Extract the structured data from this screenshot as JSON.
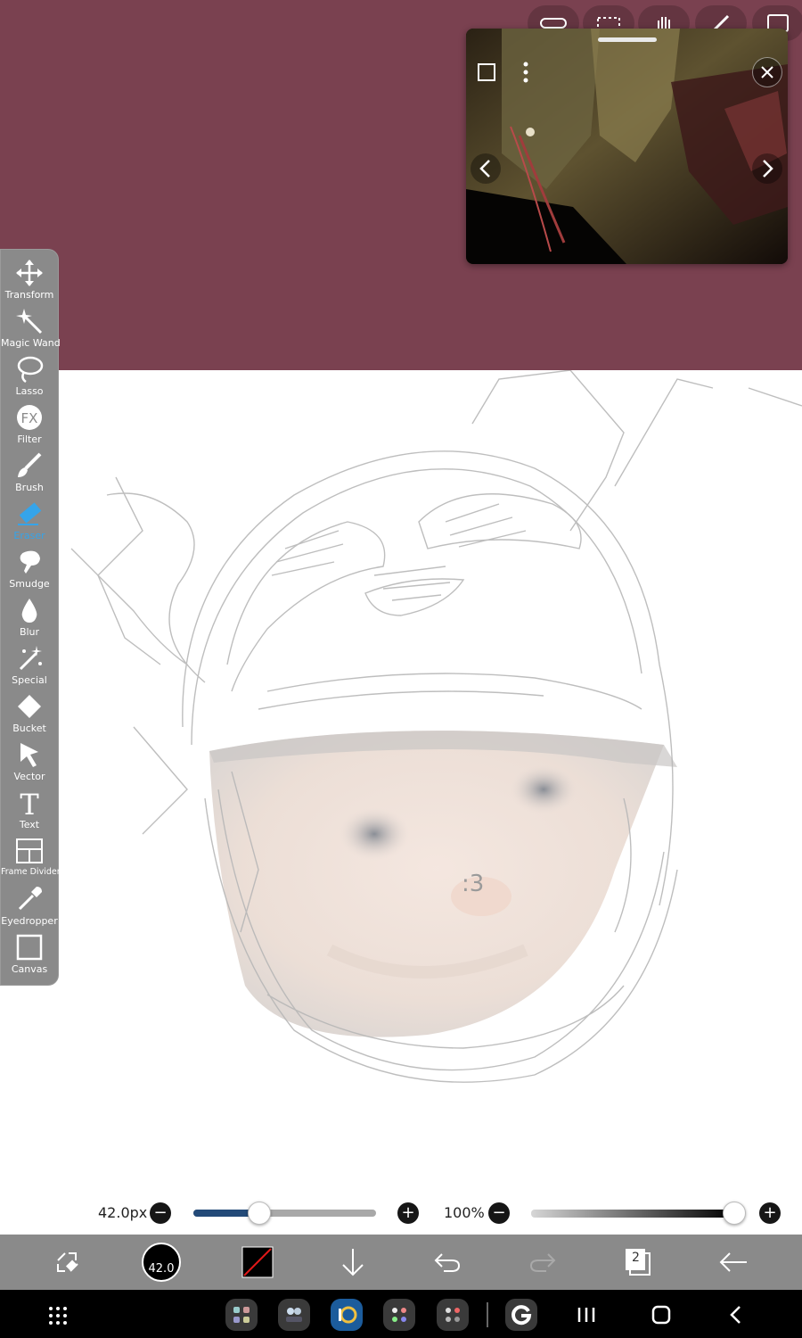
{
  "toolbar": {
    "tools": [
      {
        "label": "Transform",
        "icon": "move-arrows-icon"
      },
      {
        "label": "Magic Wand",
        "icon": "magic-wand-icon"
      },
      {
        "label": "Lasso",
        "icon": "lasso-icon"
      },
      {
        "label": "Filter",
        "icon": "fx-icon",
        "glyph": "FX"
      },
      {
        "label": "Brush",
        "icon": "brush-icon"
      },
      {
        "label": "Eraser",
        "icon": "eraser-icon",
        "active": true
      },
      {
        "label": "Smudge",
        "icon": "smudge-icon"
      },
      {
        "label": "Blur",
        "icon": "drop-icon"
      },
      {
        "label": "Special",
        "icon": "sparkle-wand-icon"
      },
      {
        "label": "Bucket",
        "icon": "bucket-icon"
      },
      {
        "label": "Vector",
        "icon": "pointer-arrow-icon"
      },
      {
        "label": "Text",
        "icon": "text-icon",
        "glyph": "T"
      },
      {
        "label": "Frame Divider",
        "icon": "frame-divider-icon"
      },
      {
        "label": "Eyedropper",
        "icon": "eyedropper-icon"
      },
      {
        "label": "Canvas",
        "icon": "canvas-icon"
      }
    ],
    "active_color": "#35a4ea"
  },
  "canvas": {
    "label": ":3"
  },
  "sliders": {
    "size_label": "42.0px",
    "size_fraction": 0.36,
    "opacity_label": "100%",
    "opacity_fraction": 1.0,
    "minus_glyph": "−",
    "plus_glyph": "+"
  },
  "bottombar": {
    "brush_size_badge": "42.0",
    "layer_count": "2"
  },
  "colors": {
    "background": "#7a4150",
    "toolbar": "#8a8a8a",
    "slider_fill": "#234a78"
  }
}
